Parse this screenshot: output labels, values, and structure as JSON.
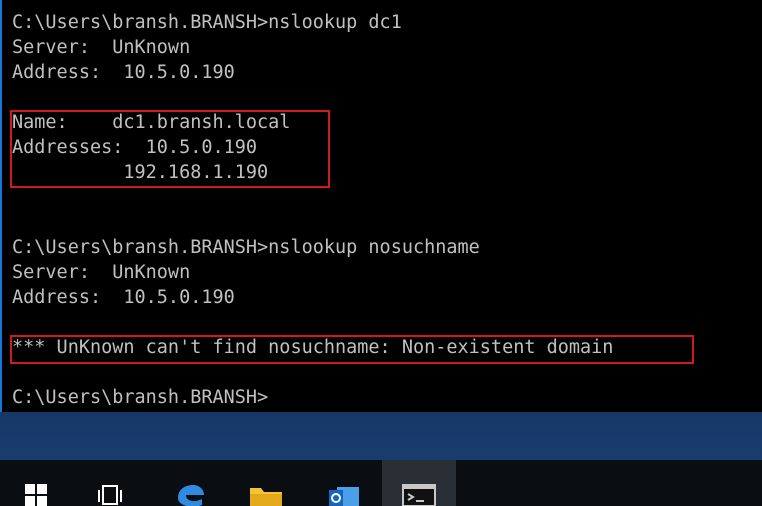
{
  "window": {
    "kind": "command-prompt",
    "lines": [
      "C:\\Users\\bransh.BRANSH>nslookup dc1",
      "Server:  UnKnown",
      "Address:  10.5.0.190",
      "",
      "Name:    dc1.bransh.local",
      "Addresses:  10.5.0.190",
      "          192.168.1.190",
      "",
      "",
      "C:\\Users\\bransh.BRANSH>nslookup nosuchname",
      "Server:  UnKnown",
      "Address:  10.5.0.190",
      "",
      "*** UnKnown can't find nosuchname: Non-existent domain",
      "",
      "C:\\Users\\bransh.BRANSH>"
    ]
  },
  "colors": {
    "console_background": "#000000",
    "console_text": "#c0c0c0",
    "highlight_border": "#d11a1a",
    "window_border": "#1b74d8",
    "taskbar": "#0a0d12"
  },
  "taskbar": {
    "items": [
      {
        "icon": "windows-start-icon"
      },
      {
        "icon": "task-view-icon"
      },
      {
        "icon": "edge-browser-icon"
      },
      {
        "icon": "file-explorer-icon"
      },
      {
        "icon": "outlook-icon"
      },
      {
        "icon": "command-prompt-icon"
      }
    ]
  }
}
